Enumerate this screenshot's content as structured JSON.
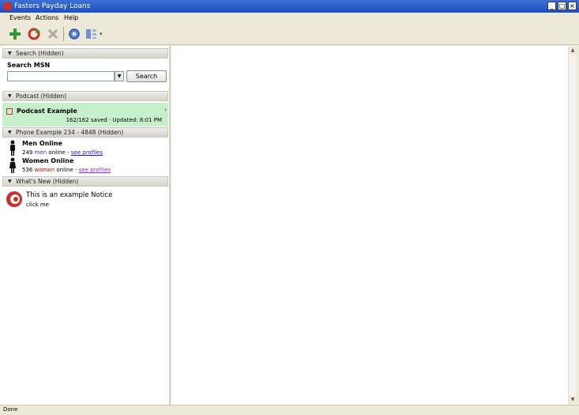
{
  "window": {
    "title": "Fasters Payday Loans",
    "buttons": {
      "minimize": "_",
      "maximize": "□",
      "close": "×"
    }
  },
  "menu": [
    "Events",
    "Actions",
    "Help"
  ],
  "toolbar": {
    "icons": [
      "add-icon",
      "refresh-icon",
      "remove-icon",
      "settings-icon",
      "view-icon"
    ]
  },
  "search_section": {
    "header": "Search (Hidden)",
    "label": "Search MSN",
    "input_value": "",
    "button_label": "Search"
  },
  "podcast_section": {
    "header": "Podcast (Hidden)",
    "item_title": "Podcast Example",
    "item_info": "162/162 saved · Updated: 8:01 PM"
  },
  "phone_section": {
    "header": "Phone Example 234 - 4848 (Hidden)",
    "men": {
      "title": "Men Online",
      "count": "249",
      "word": "men",
      "online": "online",
      "sep": "-",
      "link": "see profiles"
    },
    "women": {
      "title": "Women Online",
      "count": "536",
      "word": "women",
      "online": "online",
      "sep": "-",
      "link": "see profiles"
    }
  },
  "whats_new_section": {
    "header": "What's New (Hidden)",
    "title": "This is an example Notice",
    "subtitle": "click me"
  },
  "status": {
    "text": "Done"
  },
  "colors": {
    "title_bar": "#1c4fc0",
    "podcast_highlight": "#c6f0cc",
    "link_blue": "#1a1ad0",
    "link_purple": "#8a2be2",
    "women_red": "#cc0000"
  }
}
